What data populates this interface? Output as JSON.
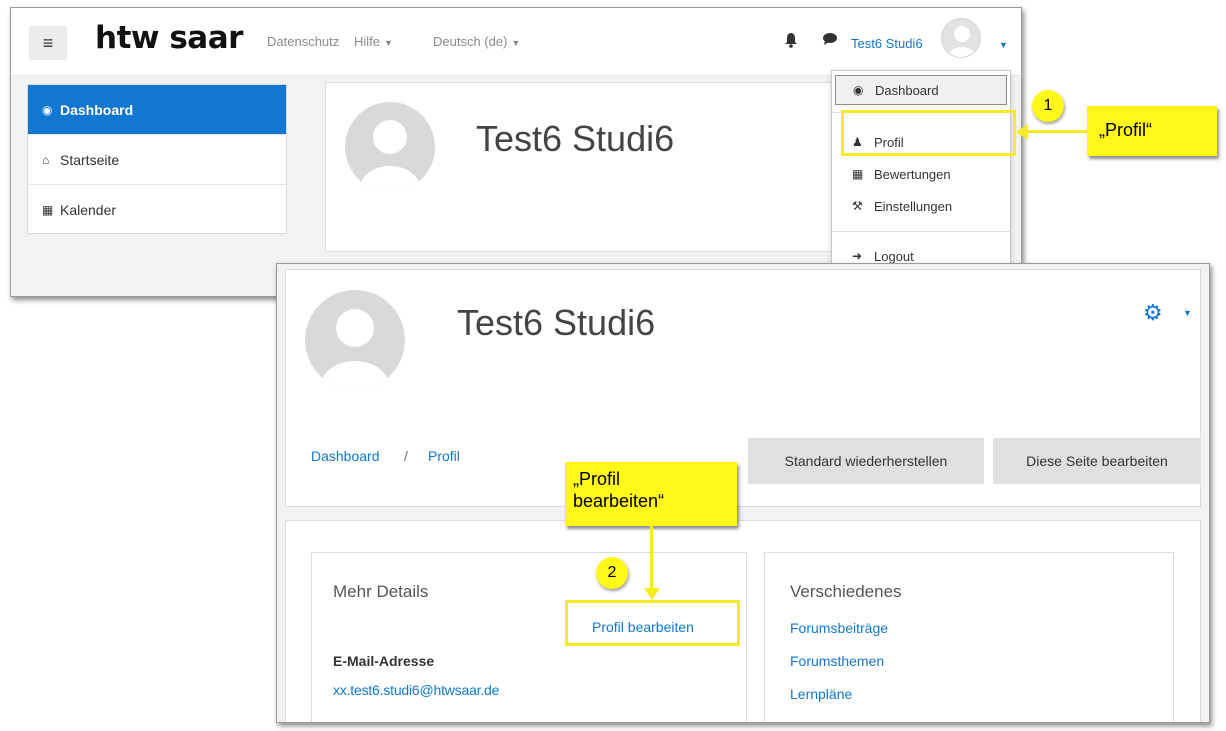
{
  "topbar": {
    "logo": "htw saar",
    "links": [
      "Datenschutz",
      "Hilfe",
      "Deutsch (de)"
    ],
    "username": "Test6 Studi6"
  },
  "sidebar": {
    "items": [
      {
        "label": "Dashboard",
        "icon": "dashboard-icon"
      },
      {
        "label": "Startseite",
        "icon": "home-icon"
      },
      {
        "label": "Kalender",
        "icon": "calendar-icon"
      }
    ]
  },
  "profile_name": "Test6 Studi6",
  "user_menu": {
    "items": [
      {
        "label": "Dashboard",
        "icon": "dashboard-icon"
      },
      {
        "label": "Profil",
        "icon": "user-icon"
      },
      {
        "label": "Bewertungen",
        "icon": "table-icon"
      },
      {
        "label": "Einstellungen",
        "icon": "wrench-icon"
      },
      {
        "label": "Logout",
        "icon": "logout-icon"
      }
    ]
  },
  "profile_page": {
    "breadcrumb": [
      "Dashboard",
      "/",
      "Profil"
    ],
    "buttons": {
      "reset": "Standard wiederherstellen",
      "edit_page": "Diese Seite bearbeiten"
    },
    "details": {
      "title": "Mehr Details",
      "edit_link": "Profil bearbeiten",
      "email_label": "E-Mail-Adresse",
      "email_value": "xx.test6.studi6@htwsaar.de"
    },
    "misc": {
      "title": "Verschiedenes",
      "links": [
        "Forumsbeiträge",
        "Forumsthemen",
        "Lernpläne"
      ]
    }
  },
  "annotations": {
    "step1_number": "1",
    "step1_label": "„Profil“",
    "step2_number": "2",
    "step2_label": "„Profil\nbearbeiten“",
    "highlight_color": "#fff61a"
  },
  "colors": {
    "accent": "#1177d1",
    "sidebar_active": "#1177d1"
  }
}
